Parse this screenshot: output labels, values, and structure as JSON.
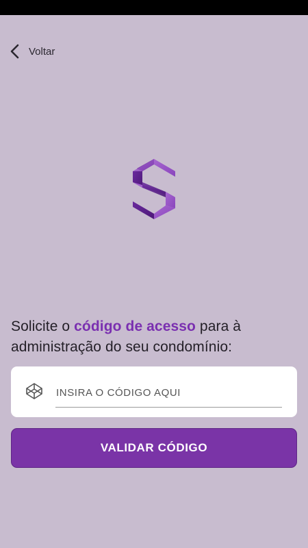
{
  "header": {
    "back_label": "Voltar"
  },
  "intro": {
    "text_before": "Solicite o ",
    "text_highlight": "código de acesso",
    "text_after": " para à administração do seu condomínio:"
  },
  "code_field": {
    "placeholder": "INSIRA O CÓDIGO AQUI",
    "value": "",
    "icon": "codepen-cube-icon"
  },
  "actions": {
    "validate_label": "VALIDAR CÓDIGO"
  },
  "colors": {
    "background": "#c8bccf",
    "accent": "#7a2fb0",
    "button": "#7a34a7",
    "logo_light": "#9b59c4",
    "logo_dark": "#5b1f8c"
  }
}
